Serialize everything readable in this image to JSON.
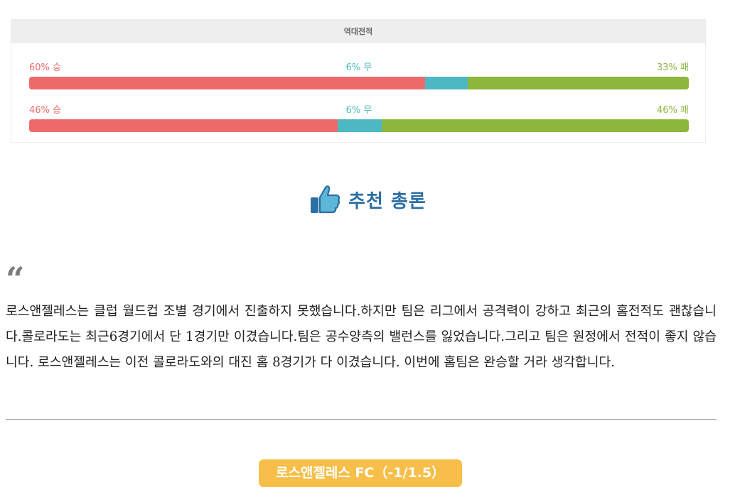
{
  "head_to_head": {
    "title": "역대전적",
    "rows": [
      {
        "win_label": "60% 승",
        "draw_label": "6% 무",
        "loss_label": "33% 패",
        "win": 60,
        "draw": 6.5,
        "loss": 33.5
      },
      {
        "win_label": "46% 승",
        "draw_label": "6% 무",
        "loss_label": "46% 패",
        "win": 46.8,
        "draw": 6.7,
        "loss": 46.5
      }
    ],
    "colors": {
      "win": "#ee6a6a",
      "draw": "#4db8c4",
      "loss": "#8db63f"
    }
  },
  "recommendation": {
    "icon": "thumbs-up-icon",
    "title": "추천 총론",
    "color": "#2d6fa3"
  },
  "summary": {
    "quote_mark": "“",
    "text": "로스앤젤레스는 클럽 월드컵 조별 경기에서 진출하지 못했습니다.하지만 팀은 리그에서 공격력이 강하고 최근의 홈전적도 괜찮습니다.콜로라도는 최근6경기에서 단 1경기만 이겼습니다.팀은 공수양측의 밸런스를 잃었습니다.그리고 팀은 원정에서 전적이 좋지 않습니다. 로스앤젤레스는 이전 콜로라도와의 대진 홈 8경기가 다 이겼습니다. 이번에 홈팀은 완승할 거라 생각합니다."
  },
  "pick": {
    "label": "로스앤젤레스 FC（-1/1.5）",
    "color": "#f7bf49"
  }
}
